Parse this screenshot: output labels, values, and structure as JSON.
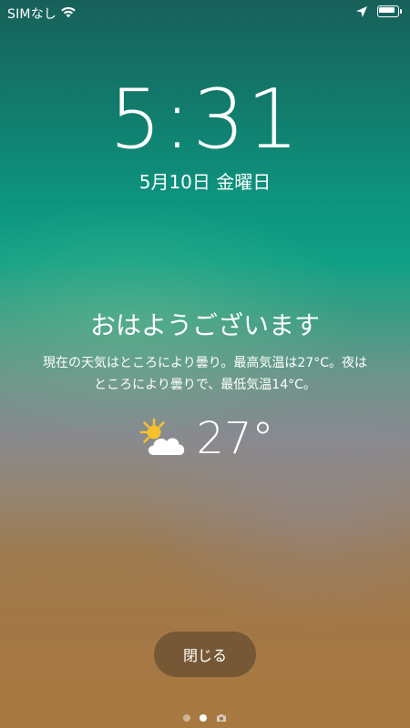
{
  "status_bar": {
    "carrier": "SIMなし",
    "wifi_icon": "wifi-icon",
    "location_icon": "location-arrow-icon",
    "battery_level": 1.0
  },
  "lock_screen": {
    "time": "5:31",
    "date": "5月10日 金曜日"
  },
  "notification": {
    "greeting": "おはようございます",
    "forecast_line1": "現在の天気はところにより曇り。最高気温は27°C。夜は",
    "forecast_line2": "ところにより曇りで、最低気温14°C。",
    "weather_icon": "partly-cloudy-icon",
    "temperature": "27°",
    "close_label": "閉じる"
  },
  "page_indicator": {
    "pages": 2,
    "active_index": 1,
    "camera_icon": "camera-icon"
  },
  "colors": {
    "sun": "#f6c12f",
    "cloud": "#ffffff",
    "button_bg": "#5a462d"
  }
}
